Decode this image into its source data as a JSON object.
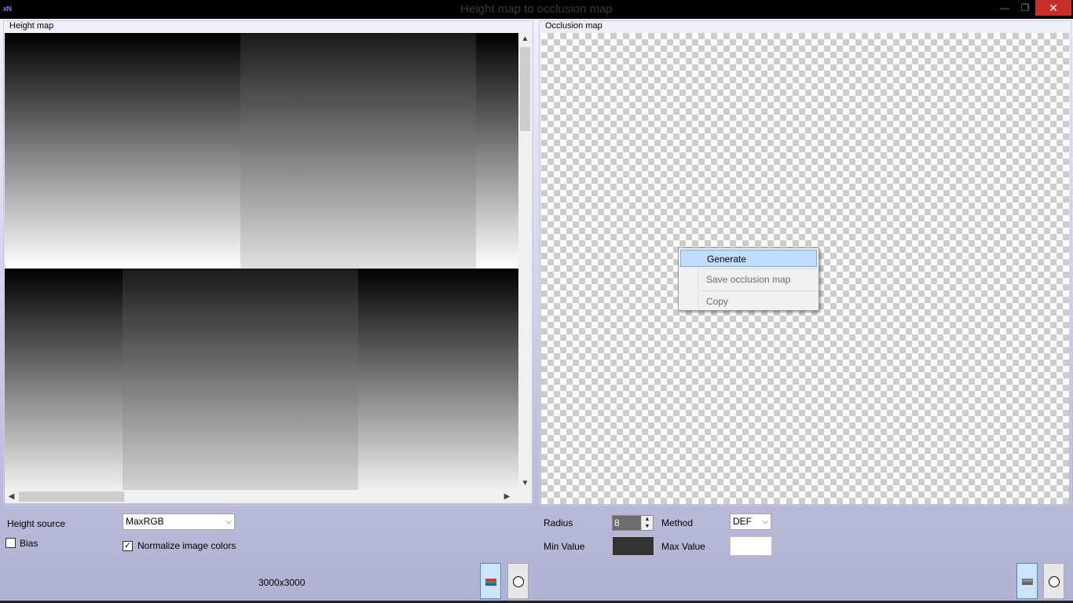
{
  "window": {
    "app_icon": "xN",
    "title": "Height map to occlusion map",
    "minimize": "—",
    "maximize": "❐",
    "close": "✕"
  },
  "height_panel": {
    "label": "Height map",
    "scroll_up": "▲",
    "scroll_down": "▼",
    "scroll_left": "◀",
    "scroll_right": "▶"
  },
  "occlusion_panel": {
    "label": "Occlusion map"
  },
  "context_menu": {
    "items": [
      {
        "label": "Generate",
        "state": "highlighted"
      },
      {
        "label": "Save occlusion map",
        "state": "disabled"
      },
      {
        "label": "Copy",
        "state": "disabled"
      }
    ]
  },
  "left_controls": {
    "height_source_label": "Height source",
    "height_source_value": "MaxRGB",
    "bias_label": "Bias",
    "bias_checked": false,
    "normalize_label": "Normalize image colors",
    "normalize_checked": true,
    "normalize_mark": "✓",
    "dimensions": "3000x3000"
  },
  "right_controls": {
    "radius_label": "Radius",
    "radius_value": "8",
    "method_label": "Method",
    "method_value": "DEF",
    "min_value_label": "Min Value",
    "max_value_label": "Max Value",
    "min_value_color": "#333333",
    "max_value_color": "#ffffff"
  },
  "icons": {
    "rgb_view": "rgb-channels-icon",
    "circle_view": "circle-icon",
    "grey_view": "grey-rect-icon",
    "circle_view_right": "circle-icon"
  }
}
